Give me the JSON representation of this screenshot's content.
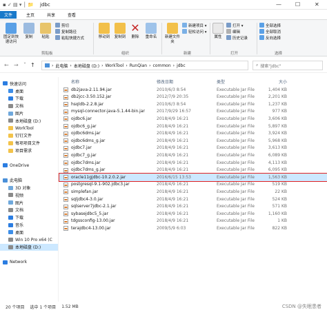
{
  "window": {
    "title": "jdbc",
    "controls": [
      "—",
      "☐",
      "✕"
    ]
  },
  "ribbon_tabs": [
    "文件",
    "主页",
    "共享",
    "查看"
  ],
  "ribbon": {
    "pin": "固定到快速访问",
    "copy": "复制",
    "paste": "粘贴",
    "copy_path": "复制路径",
    "paste_shortcut": "粘贴快捷方式",
    "cut": "剪切",
    "clipboard": "剪贴板",
    "move_to": "移动到",
    "copy_to": "复制到",
    "delete": "删除",
    "rename": "重命名",
    "organize": "组织",
    "new_folder": "新建文件夹",
    "new_item": "新建项目 ▾",
    "easy_access": "轻松访问 ▾",
    "new": "新建",
    "properties": "属性",
    "open": "打开 ▾",
    "edit": "编辑",
    "history": "历史记录",
    "open_group": "打开",
    "select_all": "全部选择",
    "select_none": "全部取消",
    "invert": "反向选择",
    "select": "选择"
  },
  "address": {
    "path": [
      "此电脑",
      "本地磁盘 (D:)",
      "WorkTool",
      "RunQian",
      "common",
      "jdbc"
    ],
    "search_placeholder": "搜索\"jdbc\""
  },
  "sidebar": [
    {
      "label": "快速访问",
      "color": "#2b7de1"
    },
    {
      "label": "桌面",
      "color": "#3d8ee8"
    },
    {
      "label": "下载",
      "color": "#2b7de1"
    },
    {
      "label": "文档",
      "color": "#8a8a8a"
    },
    {
      "label": "图片",
      "color": "#6fa8dc"
    },
    {
      "label": "本地磁盘 (D:)",
      "color": "#8a8a8a"
    },
    {
      "label": "WorkTool",
      "color": "#f3c34a"
    },
    {
      "label": "钉钉文件",
      "color": "#f3c34a"
    },
    {
      "label": "每项项目文件",
      "color": "#f3c34a"
    },
    {
      "label": "项目需求",
      "color": "#f3c34a"
    },
    {
      "label": "",
      "color": "#ffffff"
    },
    {
      "label": "OneDrive",
      "color": "#2b7de1"
    },
    {
      "label": "",
      "color": "#ffffff"
    },
    {
      "label": "此电脑",
      "color": "#4a90d9"
    },
    {
      "label": "3D 对象",
      "color": "#6fa8dc"
    },
    {
      "label": "视频",
      "color": "#8a8a8a"
    },
    {
      "label": "图片",
      "color": "#6fa8dc"
    },
    {
      "label": "文档",
      "color": "#8a8a8a"
    },
    {
      "label": "下载",
      "color": "#2b7de1"
    },
    {
      "label": "音乐",
      "color": "#2b7de1"
    },
    {
      "label": "桌面",
      "color": "#3d8ee8"
    },
    {
      "label": "Win 10 Pro x64 (C",
      "color": "#8a8a8a"
    },
    {
      "label": "本地磁盘 (D:)",
      "color": "#8a8a8a"
    },
    {
      "label": "",
      "color": "#ffffff"
    },
    {
      "label": "Network",
      "color": "#2b7de1"
    }
  ],
  "columns": {
    "name": "名称",
    "date": "修改日期",
    "type": "类型",
    "size": "大小"
  },
  "files": [
    {
      "name": "db2java-2.11.94.jar",
      "date": "2010/6/3 8:54",
      "type": "Executable Jar File",
      "size": "1,404 KB"
    },
    {
      "name": "db2jcc-3.50.152.jar",
      "date": "2012/7/9 20:35",
      "type": "Executable Jar File",
      "size": "2,201 KB"
    },
    {
      "name": "hsqldb-2.2.8.jar",
      "date": "2010/6/3 8:54",
      "type": "Executable Jar File",
      "size": "1,237 KB"
    },
    {
      "name": "mysql-connector-java-5.1.44-bin.jar",
      "date": "2017/9/29 16:57",
      "type": "Executable Jar File",
      "size": "977 KB"
    },
    {
      "name": "ojdbc6.jar",
      "date": "2018/4/9 16:21",
      "type": "Executable Jar File",
      "size": "3,606 KB"
    },
    {
      "name": "ojdbc6_g.jar",
      "date": "2018/4/9 16:21",
      "type": "Executable Jar File",
      "size": "5,897 KB"
    },
    {
      "name": "ojdbc6dms.jar",
      "date": "2018/4/9 16:21",
      "type": "Executable Jar File",
      "size": "3,924 KB"
    },
    {
      "name": "ojdbc6dms_g.jar",
      "date": "2018/4/9 16:21",
      "type": "Executable Jar File",
      "size": "5,968 KB"
    },
    {
      "name": "ojdbc7.jar",
      "date": "2018/4/9 16:21",
      "type": "Executable Jar File",
      "size": "3,613 KB"
    },
    {
      "name": "ojdbc7_g.jar",
      "date": "2018/4/9 16:21",
      "type": "Executable Jar File",
      "size": "6,089 KB"
    },
    {
      "name": "ojdbc7dms.jar",
      "date": "2018/4/9 16:21",
      "type": "Executable Jar File",
      "size": "4,113 KB"
    },
    {
      "name": "ojdbc7dms_g.jar",
      "date": "2018/4/9 16:21",
      "type": "Executable Jar File",
      "size": "6,095 KB"
    },
    {
      "name": "oracle11gjdbc-10.2.0.2.jar",
      "date": "2016/6/15 13:53",
      "type": "Executable Jar File",
      "size": "1,563 KB"
    },
    {
      "name": "postgresql-9.1-902.jdbc3.jar",
      "date": "2018/4/9 16:21",
      "type": "Executable Jar File",
      "size": "519 KB"
    },
    {
      "name": "simplefan.jar",
      "date": "2018/4/9 16:21",
      "type": "Executable Jar File",
      "size": "22 KB"
    },
    {
      "name": "sqljdbc4-3.0.jar",
      "date": "2018/4/9 16:21",
      "type": "Executable Jar File",
      "size": "524 KB"
    },
    {
      "name": "sqlserver7jdbc-2.1.jar",
      "date": "2018/4/9 16:21",
      "type": "Executable Jar File",
      "size": "571 KB"
    },
    {
      "name": "sybasejdbc5_5.jar",
      "date": "2018/4/9 16:21",
      "type": "Executable Jar File",
      "size": "1,160 KB"
    },
    {
      "name": "tdgssconfig-13.00.jar",
      "date": "2018/4/9 16:21",
      "type": "Executable Jar File",
      "size": "1 KB"
    },
    {
      "name": "terajdbc4-13.00.jar",
      "date": "2009/5/9 6:03",
      "type": "Executable Jar File",
      "size": "822 KB"
    }
  ],
  "selected_index": 12,
  "status": {
    "count": "20 个项目",
    "selected": "选中 1 个项目",
    "size": "1.52 MB"
  },
  "watermark": "CSDN @失眠患者"
}
